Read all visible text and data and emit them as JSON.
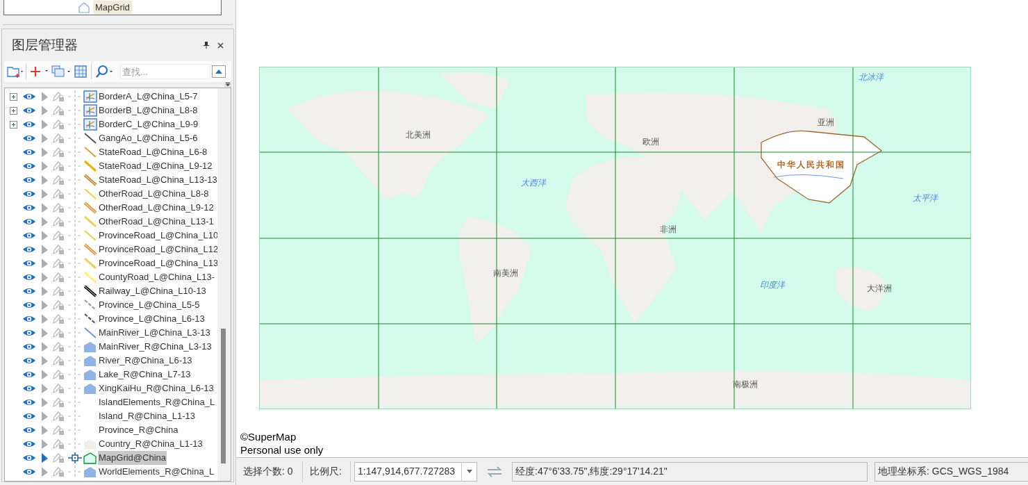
{
  "workspace_tree": {
    "item": "MapGrid"
  },
  "layer_manager": {
    "title": "图层管理器",
    "search": {
      "placeholder": "查找..."
    },
    "layers": [
      {
        "name": "BorderA_L@China_L5-7",
        "expandable": true,
        "visible": true,
        "kind": "theme",
        "selected": false
      },
      {
        "name": "BorderB_L@China_L8-8",
        "expandable": true,
        "visible": true,
        "kind": "theme",
        "selected": false
      },
      {
        "name": "BorderC_L@China_L9-9",
        "expandable": true,
        "visible": true,
        "kind": "theme",
        "selected": false
      },
      {
        "name": "GangAo_L@China_L5-6",
        "expandable": false,
        "visible": true,
        "kind": "thin",
        "color": "#555555",
        "selected": false
      },
      {
        "name": "StateRoad_L@China_L6-8",
        "expandable": false,
        "visible": true,
        "kind": "thin",
        "color": "#e0a030",
        "selected": false
      },
      {
        "name": "StateRoad_L@China_L9-12",
        "expandable": false,
        "visible": true,
        "kind": "thick",
        "color": "#f0b000",
        "selected": false
      },
      {
        "name": "StateRoad_L@China_L13-13",
        "expandable": false,
        "visible": true,
        "kind": "double",
        "color": "#c08020",
        "selected": false
      },
      {
        "name": "OtherRoad_L@China_L8-8",
        "expandable": false,
        "visible": true,
        "kind": "thin",
        "color": "#f0d040",
        "selected": false
      },
      {
        "name": "OtherRoad_L@China_L9-12",
        "expandable": false,
        "visible": true,
        "kind": "double",
        "color": "#e09030",
        "selected": false
      },
      {
        "name": "OtherRoad_L@China_L13-1",
        "expandable": false,
        "visible": true,
        "kind": "thick",
        "color": "#f0d060",
        "selected": false
      },
      {
        "name": "ProvinceRoad_L@China_L10",
        "expandable": false,
        "visible": true,
        "kind": "thin",
        "color": "#f0d040",
        "selected": false
      },
      {
        "name": "ProvinceRoad_L@China_L12",
        "expandable": false,
        "visible": true,
        "kind": "double",
        "color": "#e09030",
        "selected": false
      },
      {
        "name": "ProvinceRoad_L@China_L13",
        "expandable": false,
        "visible": true,
        "kind": "thick",
        "color": "#f0d060",
        "selected": false
      },
      {
        "name": "CountyRoad_L@China_L13-",
        "expandable": false,
        "visible": true,
        "kind": "thick",
        "color": "#fff080",
        "selected": false
      },
      {
        "name": "Railway_L@China_L10-13",
        "expandable": false,
        "visible": true,
        "kind": "double",
        "color": "#000000",
        "selected": false
      },
      {
        "name": "Province_L@China_L5-5",
        "expandable": false,
        "visible": true,
        "kind": "dashed",
        "color": "#999999",
        "selected": false
      },
      {
        "name": "Province_L@China_L6-13",
        "expandable": false,
        "visible": true,
        "kind": "dashed",
        "color": "#555555",
        "selected": false
      },
      {
        "name": "MainRiver_L@China_L3-13",
        "expandable": false,
        "visible": true,
        "kind": "thin",
        "color": "#6a9ad8",
        "selected": false
      },
      {
        "name": "MainRiver_R@China_L3-13",
        "expandable": false,
        "visible": true,
        "kind": "region",
        "color": "#8fb4e6",
        "selected": false
      },
      {
        "name": "River_R@China_L6-13",
        "expandable": false,
        "visible": true,
        "kind": "region",
        "color": "#8fb4e6",
        "selected": false
      },
      {
        "name": "Lake_R@China_L7-13",
        "expandable": false,
        "visible": true,
        "kind": "region",
        "color": "#8fb4e6",
        "selected": false
      },
      {
        "name": "XingKaiHu_R@China_L6-13",
        "expandable": false,
        "visible": true,
        "kind": "region",
        "color": "#8fb4e6",
        "selected": false
      },
      {
        "name": "IslandElements_R@China_L",
        "expandable": false,
        "visible": true,
        "kind": "none",
        "selected": false
      },
      {
        "name": "Island_R@China_L1-13",
        "expandable": false,
        "visible": true,
        "kind": "none",
        "selected": false
      },
      {
        "name": "Province_R@China",
        "expandable": false,
        "visible": true,
        "kind": "none",
        "selected": false
      },
      {
        "name": "Country_R@China_L1-13",
        "expandable": false,
        "visible": true,
        "kind": "region",
        "color": "#f0efeb",
        "selected": false
      },
      {
        "name": "MapGrid@China",
        "expandable": false,
        "visible": true,
        "kind": "grid",
        "color": "#d8fbee",
        "selected": true
      },
      {
        "name": "WorldElements_R@China_L",
        "expandable": false,
        "visible": true,
        "kind": "region",
        "color": "#8fb4e6",
        "selected": false
      }
    ]
  },
  "map": {
    "labels": [
      {
        "text": "北冰洋",
        "kind": "ocean"
      },
      {
        "text": "北美洲",
        "kind": "land"
      },
      {
        "text": "欧洲",
        "kind": "land"
      },
      {
        "text": "亚洲",
        "kind": "land"
      },
      {
        "text": "中华人民共和国",
        "kind": "country"
      },
      {
        "text": "大西洋",
        "kind": "ocean"
      },
      {
        "text": "太平洋",
        "kind": "ocean"
      },
      {
        "text": "非洲",
        "kind": "land"
      },
      {
        "text": "南美洲",
        "kind": "land"
      },
      {
        "text": "印度洋",
        "kind": "ocean"
      },
      {
        "text": "大洋洲",
        "kind": "land"
      },
      {
        "text": "南极洲",
        "kind": "land"
      }
    ],
    "copyright": "©SuperMap",
    "license": "Personal use only"
  },
  "status_bar": {
    "selection_label": "选择个数: 0",
    "scale_label": "比例尺:",
    "scale_value": "1:147,914,677.727283",
    "coordinates": "经度:47°6'33.75\",纬度:29°17'14.21\"",
    "crs": "地理坐标系: GCS_WGS_1984"
  }
}
